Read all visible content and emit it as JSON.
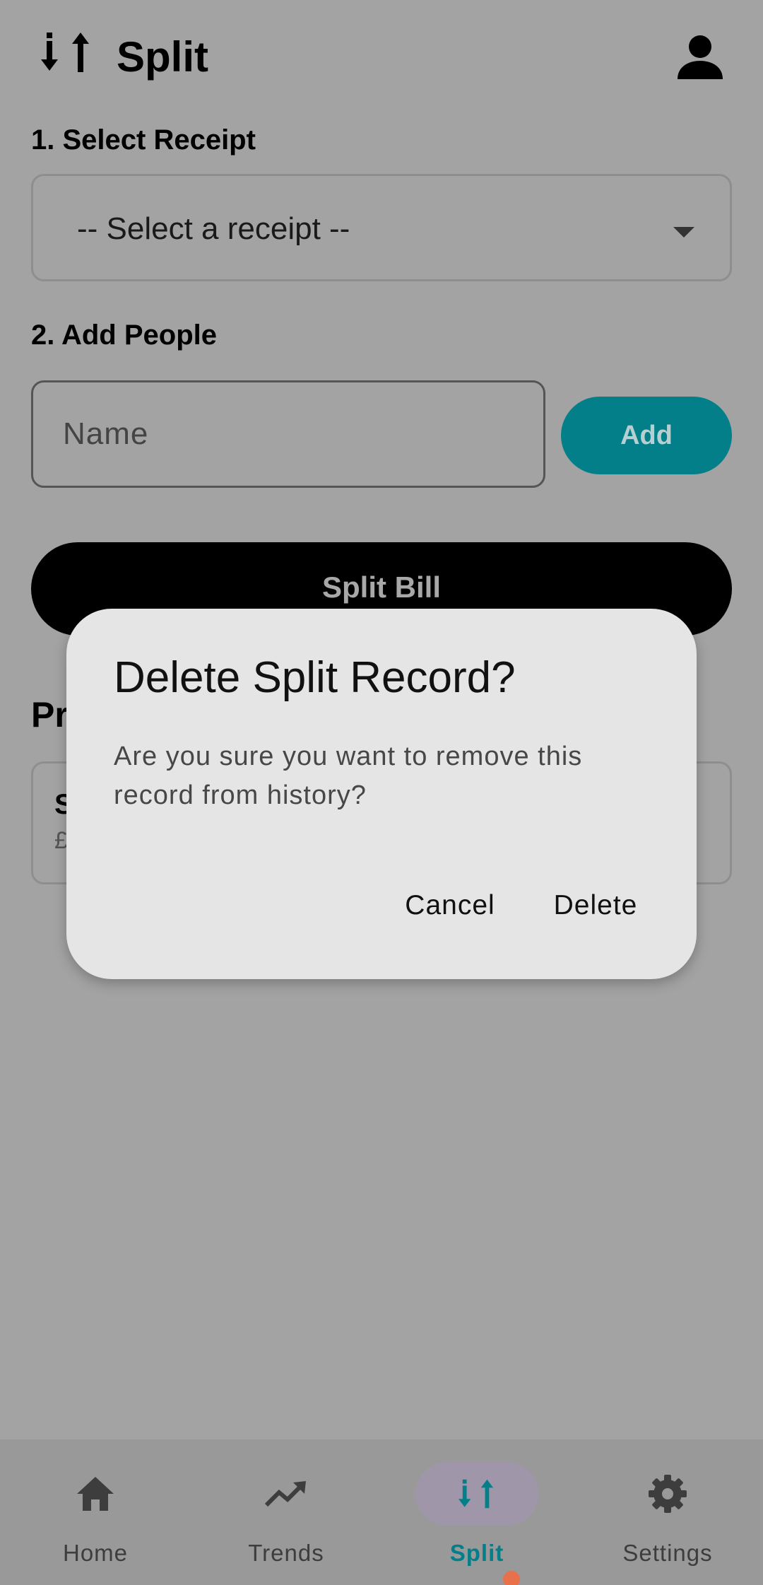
{
  "app_bar": {
    "title": "Split",
    "logo_icon": "split-arrows-icon",
    "profile_icon": "person-icon"
  },
  "receipt_section": {
    "label": "1. Select Receipt",
    "selected_value": "-- Select a receipt --",
    "caret_icon": "dropdown-caret-icon"
  },
  "people_section": {
    "label": "2. Add People",
    "name_placeholder": "Name",
    "add_label": "Add"
  },
  "split_bill_label": "Split Bill",
  "history": {
    "title": "Pr",
    "card_name": "S",
    "card_amount": "£"
  },
  "dialog": {
    "title": "Delete Split Record?",
    "message": "Are you sure you want to remove this record from history?",
    "cancel_label": "Cancel",
    "delete_label": "Delete"
  },
  "bottom_nav": {
    "items": [
      {
        "label": "Home",
        "icon": "home-icon"
      },
      {
        "label": "Trends",
        "icon": "trending-up-icon"
      },
      {
        "label": "Split",
        "icon": "split-arrows-icon",
        "active": true
      },
      {
        "label": "Settings",
        "icon": "gear-icon"
      }
    ]
  },
  "colors": {
    "scrim": "#a3a3a3",
    "accent": "#027f89",
    "dialog_bg": "#e5e5e5",
    "active_pill": "#a096aa"
  }
}
